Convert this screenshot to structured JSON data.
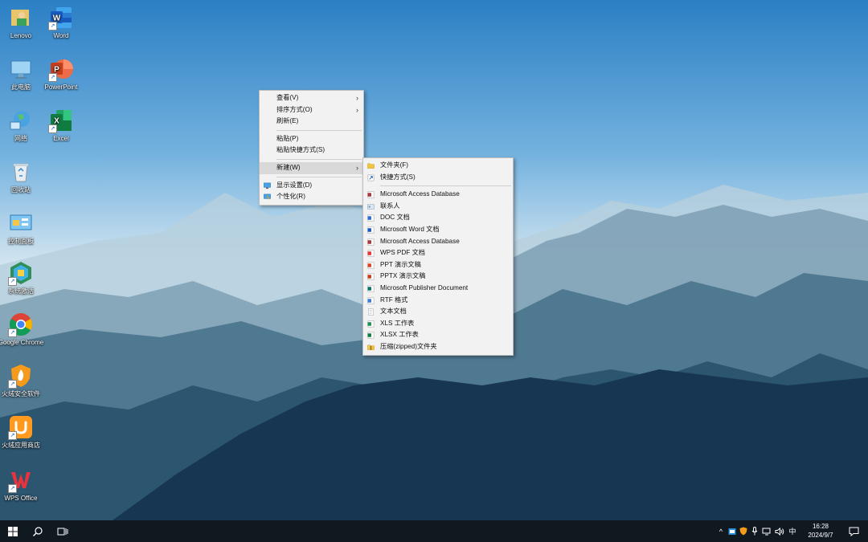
{
  "desktop": {
    "icons": [
      {
        "label": "Lenovo"
      },
      {
        "label": "Word"
      },
      {
        "label": "此电脑"
      },
      {
        "label": "PowerPoint"
      },
      {
        "label": "网络"
      },
      {
        "label": "Excel"
      },
      {
        "label": "回收站"
      },
      {
        "label": "控制面板"
      },
      {
        "label": "系统激活"
      },
      {
        "label": "Google Chrome"
      },
      {
        "label": "火绒安全软件"
      },
      {
        "label": "火绒应用商店"
      },
      {
        "label": "WPS Office"
      }
    ]
  },
  "context_menu": {
    "items": [
      {
        "label": "查看(V)"
      },
      {
        "label": "排序方式(O)"
      },
      {
        "label": "刷新(E)"
      },
      {
        "label": "粘贴(P)"
      },
      {
        "label": "粘贴快捷方式(S)"
      },
      {
        "label": "新建(W)"
      },
      {
        "label": "显示设置(D)"
      },
      {
        "label": "个性化(R)"
      }
    ]
  },
  "new_submenu": {
    "items": [
      {
        "label": "文件夹(F)",
        "icon": "folder-icon"
      },
      {
        "label": "快捷方式(S)",
        "icon": "shortcut-icon"
      },
      {
        "label": "Microsoft Access Database",
        "icon": "access-icon"
      },
      {
        "label": "联系人",
        "icon": "contact-icon"
      },
      {
        "label": "DOC 文档",
        "icon": "doc-icon"
      },
      {
        "label": "Microsoft Word 文档",
        "icon": "word-icon"
      },
      {
        "label": "Microsoft Access Database",
        "icon": "access-icon"
      },
      {
        "label": "WPS PDF 文档",
        "icon": "pdf-icon"
      },
      {
        "label": "PPT 演示文稿",
        "icon": "ppt-icon"
      },
      {
        "label": "PPTX 演示文稿",
        "icon": "pptx-icon"
      },
      {
        "label": "Microsoft Publisher Document",
        "icon": "publisher-icon"
      },
      {
        "label": "RTF 格式",
        "icon": "rtf-icon"
      },
      {
        "label": "文本文档",
        "icon": "text-icon"
      },
      {
        "label": "XLS 工作表",
        "icon": "xls-icon"
      },
      {
        "label": "XLSX 工作表",
        "icon": "xlsx-icon"
      },
      {
        "label": "压缩(zipped)文件夹",
        "icon": "zip-icon"
      }
    ]
  },
  "taskbar": {
    "ime": "中",
    "time": "16:28",
    "date": "2024/9/7"
  },
  "colors": {
    "menu_bg": "#f2f2f2",
    "menu_highlight": "#d9d9d9",
    "taskbar_bg": "#101820"
  }
}
